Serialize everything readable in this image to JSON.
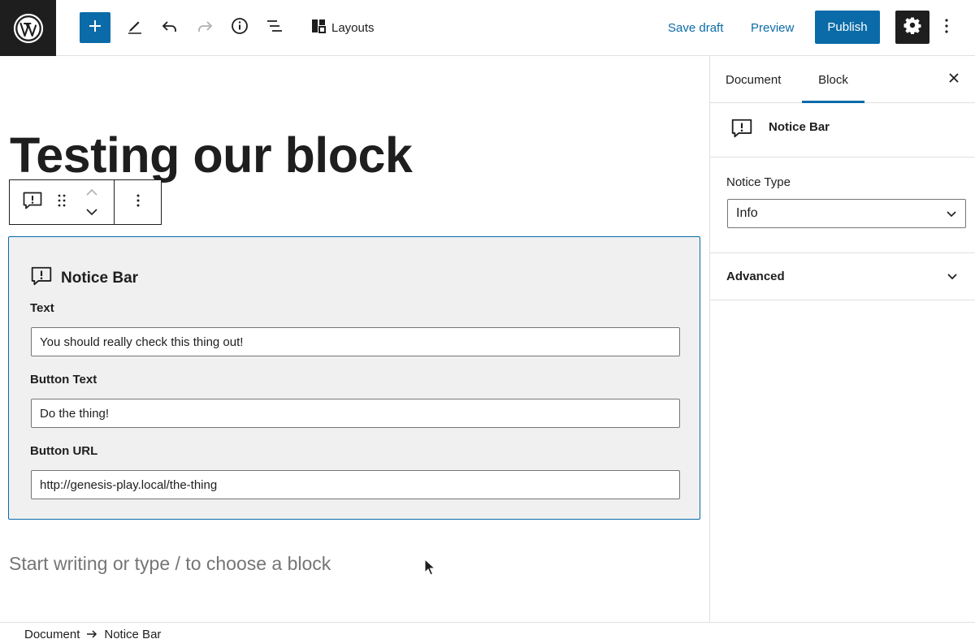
{
  "header": {
    "layouts_label": "Layouts",
    "save_draft_label": "Save draft",
    "preview_label": "Preview",
    "publish_label": "Publish"
  },
  "icons": {
    "logo": "wordpress-logo-icon",
    "add": "plus-icon",
    "tools": "pencil-icon",
    "undo": "undo-icon",
    "redo": "redo-icon",
    "info": "info-icon",
    "outline": "list-view-icon",
    "layouts": "layouts-icon",
    "settings": "gear-icon",
    "more": "more-vertical-icon"
  },
  "colors": {
    "accent": "#0a6ba8",
    "dark": "#1e1e1e",
    "block_bg": "#f0f0f1",
    "placeholder": "#757575"
  },
  "editor": {
    "post_title": "Testing our block",
    "notice_block": {
      "title": "Notice Bar",
      "text_label": "Text",
      "text_value": "You should really check this thing out!",
      "button_text_label": "Button Text",
      "button_text_value": "Do the thing!",
      "button_url_label": "Button URL",
      "button_url_value": "http://genesis-play.local/the-thing"
    },
    "placeholder": "Start writing or type / to choose a block"
  },
  "breadcrumb": {
    "items": [
      "Document",
      "Notice Bar"
    ]
  },
  "sidebar": {
    "tabs": [
      {
        "label": "Document",
        "active": false
      },
      {
        "label": "Block",
        "active": true
      }
    ],
    "block_card_title": "Notice Bar",
    "notice_type_label": "Notice Type",
    "notice_type_value": "Info",
    "advanced_label": "Advanced"
  }
}
